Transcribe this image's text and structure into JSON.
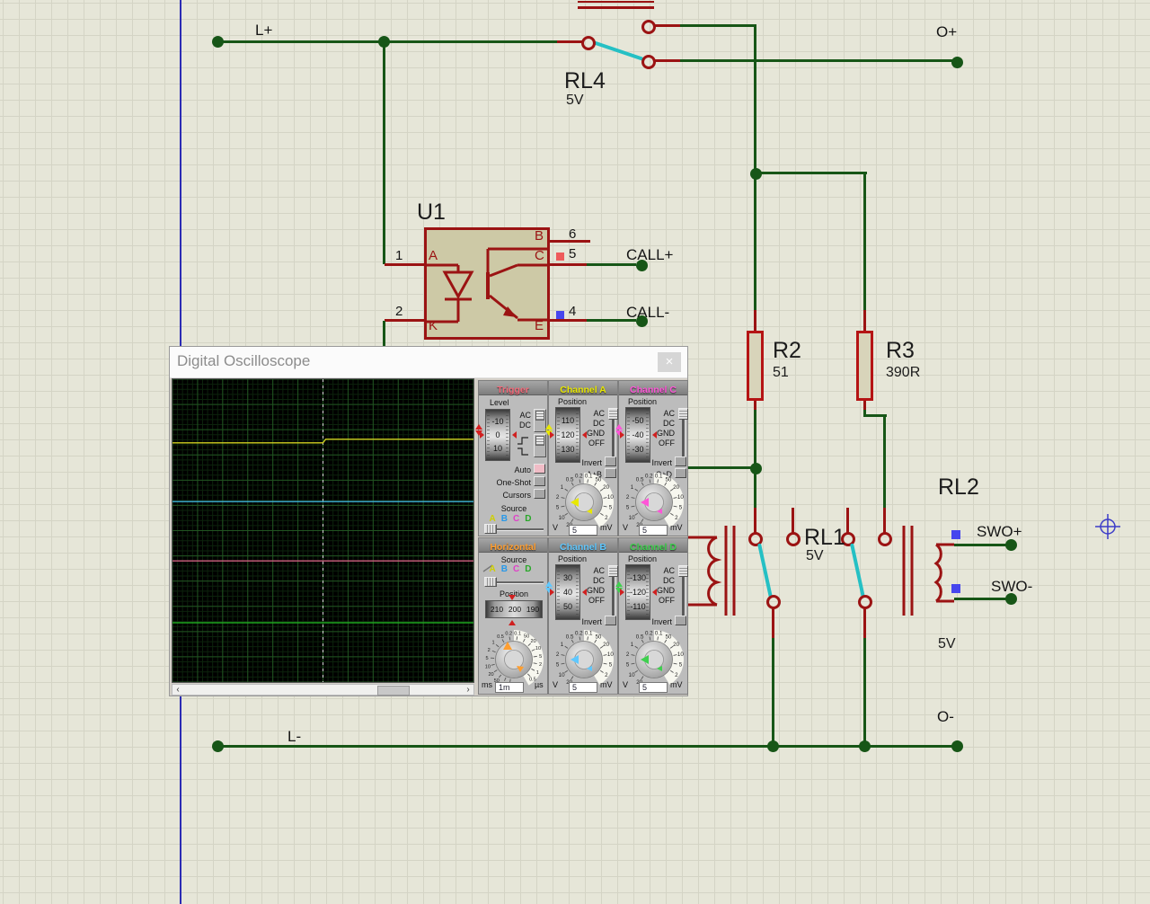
{
  "schematic": {
    "colors": {
      "canvas_bg": "#e6e6d8",
      "grid": "#d4d4c5",
      "wire_green": "#175617",
      "component_red": "#9b1313",
      "resistor_red": "#b51414",
      "component_fill": "#cdc9a6",
      "switch_cyan": "#25c0c4",
      "pin_marker_blue": "#4646ee",
      "pin_marker_red": "#ee5b5b",
      "sheet_border_blue": "#2b2bb4",
      "crosshair_blue": "#3c3cc8"
    },
    "nets": {
      "l_plus": "L+",
      "l_minus": "L-",
      "o_plus": "O+",
      "o_minus": "O-",
      "call_plus": "CALL+",
      "call_minus": "CALL-",
      "swo_plus": "SWO+",
      "swo_minus": "SWO-"
    },
    "u1": {
      "ref": "U1",
      "pin_a": "A",
      "pin_k": "K",
      "pin_b": "B",
      "pin_c": "C",
      "pin_e": "E",
      "num_1": "1",
      "num_2": "2",
      "num_4": "4",
      "num_5": "5",
      "num_6": "6"
    },
    "rl4": {
      "ref": "RL4",
      "value": "5V"
    },
    "rl1": {
      "ref": "RL1",
      "value": "5V"
    },
    "rl2": {
      "ref": "RL2",
      "value": "5V"
    },
    "r2": {
      "ref": "R2",
      "value": "51"
    },
    "r3": {
      "ref": "R3",
      "value": "390R"
    }
  },
  "oscilloscope": {
    "title": "Digital Oscilloscope",
    "close_label": "×",
    "scrollbar": {
      "left": "‹",
      "right": "›"
    },
    "display": {
      "bg": "#000000",
      "grid_major": "#215421",
      "grid_minor": "#0c230c",
      "cursor": "#d8d8d8"
    },
    "source_channels": [
      {
        "label": "A",
        "color": "#cfcf00"
      },
      {
        "label": "B",
        "color": "#2898e8"
      },
      {
        "label": "C",
        "color": "#e040c8"
      },
      {
        "label": "D",
        "color": "#28a828"
      }
    ],
    "knob_scales": {
      "channel": {
        "top": [
          "0.5",
          "0.2",
          "0.1"
        ],
        "left": [
          "1",
          "2",
          "5",
          "10",
          "20"
        ],
        "right": [
          "50",
          "20",
          "10",
          "5",
          "2"
        ]
      },
      "horizontal": {
        "top": [
          "0.5",
          "0.2",
          "0.1"
        ],
        "left": [
          "1",
          "2",
          "5",
          "10",
          "20",
          "50",
          "100",
          "200"
        ],
        "right": [
          "50",
          "20",
          "10",
          "5",
          "2",
          "1",
          "0.5"
        ]
      }
    },
    "panels": {
      "trigger": {
        "title": "Trigger",
        "color": "#f56a7a",
        "arrow_color": "#d82020",
        "level_label": "Level",
        "level_values": [
          "-10",
          "0",
          "10"
        ],
        "coupling": [
          "AC",
          "DC"
        ],
        "auto_label": "Auto",
        "auto_active_color": "#f0bcc6",
        "one_shot_label": "One-Shot",
        "cursors_label": "Cursors",
        "source_label": "Source"
      },
      "channel_a": {
        "title": "Channel A",
        "color": "#e8e800",
        "position_label": "Position",
        "position_values": [
          "110",
          "120",
          "130"
        ],
        "coupling": [
          "AC",
          "DC",
          "GND",
          "OFF"
        ],
        "invert_label": "Invert",
        "sum_label": "A+B",
        "value": "5",
        "unit_left": "V",
        "unit_right": "mV"
      },
      "channel_b": {
        "title": "Channel B",
        "color": "#5fc8ff",
        "position_label": "Position",
        "position_values": [
          "30",
          "40",
          "50"
        ],
        "coupling": [
          "AC",
          "DC",
          "GND",
          "OFF"
        ],
        "invert_label": "Invert",
        "value": "5",
        "unit_left": "V",
        "unit_right": "mV"
      },
      "channel_c": {
        "title": "Channel C",
        "color": "#ff55d8",
        "position_label": "Position",
        "position_values": [
          "-50",
          "-40",
          "-30"
        ],
        "coupling": [
          "AC",
          "DC",
          "GND",
          "OFF"
        ],
        "invert_label": "Invert",
        "sum_label": "C+D",
        "value": "5",
        "unit_left": "V",
        "unit_right": "mV"
      },
      "channel_d": {
        "title": "Channel D",
        "color": "#3fd04f",
        "position_label": "Position",
        "position_values": [
          "-130",
          "-120",
          "-110"
        ],
        "coupling": [
          "AC",
          "DC",
          "GND",
          "OFF"
        ],
        "invert_label": "Invert",
        "value": "5",
        "unit_left": "V",
        "unit_right": "mV"
      },
      "horizontal": {
        "title": "Horizontal",
        "color": "#ff9e30",
        "source_label": "Source",
        "position_label": "Position",
        "position_values": [
          "210",
          "200",
          "190"
        ],
        "value": "1m",
        "unit_left": "ms",
        "unit_right": "µs"
      }
    }
  },
  "chart_data": {
    "type": "line",
    "title": "Digital Oscilloscope display",
    "x_divisions": 12,
    "y_divisions": 12,
    "grid": true,
    "legend": "none",
    "cursor": {
      "x_div": 6,
      "style": "dashed-vertical"
    },
    "series": [
      {
        "name": "Channel A",
        "color": "#d0d020",
        "y_div": 2.45,
        "shape": "flat",
        "step_at_center": true,
        "step_divs": 0.07
      },
      {
        "name": "Channel B",
        "color": "#3fb4d8",
        "y_div": 4.85,
        "shape": "flat",
        "step_at_center": false
      },
      {
        "name": "Channel C",
        "color": "#cf6080",
        "y_div": 7.2,
        "shape": "flat",
        "step_at_center": false
      },
      {
        "name": "Channel D",
        "color": "#1fa51f",
        "y_div": 9.65,
        "shape": "flat",
        "step_at_center": false
      }
    ]
  }
}
